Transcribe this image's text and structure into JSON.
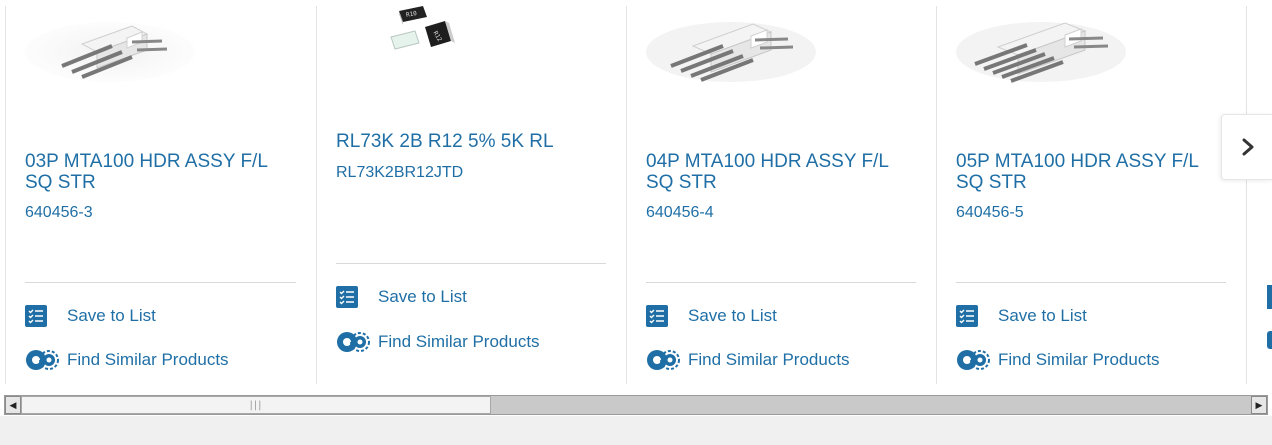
{
  "carousel": {
    "cards": [
      {
        "title": "03P MTA100 HDR ASSY F/L SQ STR",
        "part_number": "640456-3",
        "save_label": "Save to List",
        "similar_label": "Find Similar Products",
        "image": "connector-header-3-pin"
      },
      {
        "title": "RL73K 2B R12 5% 5K RL",
        "part_number": "RL73K2BR12JTD",
        "save_label": "Save to List",
        "similar_label": "Find Similar Products",
        "image": "smd-resistors",
        "image_text": [
          "R10",
          "R12"
        ]
      },
      {
        "title": "04P MTA100 HDR ASSY F/L SQ STR",
        "part_number": "640456-4",
        "save_label": "Save to List",
        "similar_label": "Find Similar Products",
        "image": "connector-header-4-pin"
      },
      {
        "title": "05P MTA100 HDR ASSY F/L SQ STR",
        "part_number": "640456-5",
        "save_label": "Save to List",
        "similar_label": "Find Similar Products",
        "image": "connector-header-5-pin"
      }
    ],
    "next_icon": "chevron-right-icon"
  },
  "scrollbar": {
    "left_arrow": "◀",
    "right_arrow": "▶",
    "grip": "|||"
  },
  "colors": {
    "link": "#1f6fa6",
    "divider": "#e3e3e3",
    "scrollbar_track": "#c9c9c9"
  }
}
